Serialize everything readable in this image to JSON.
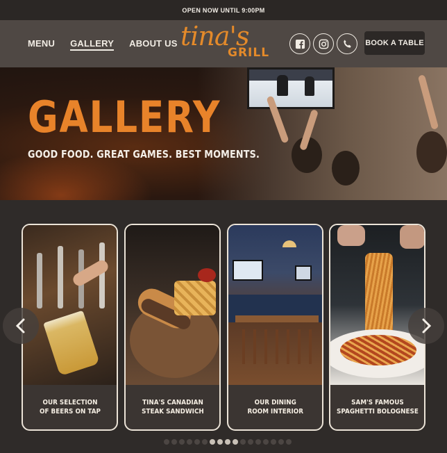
{
  "topbar": {
    "text": "OPEN NOW UNTIL 9:00PM"
  },
  "nav": {
    "links": [
      {
        "label": "MENU",
        "active": false
      },
      {
        "label": "GALLERY",
        "active": true
      },
      {
        "label": "ABOUT US",
        "active": false
      }
    ],
    "logo": {
      "script": "tina's",
      "wordmark": "GRILL"
    },
    "social": [
      "facebook-icon",
      "instagram-icon",
      "phone-icon"
    ],
    "book_label": "BOOK A TABLE"
  },
  "hero": {
    "title": "GALLERY",
    "subtitle": "GOOD FOOD. GREAT GAMES. BEST MOMENTS."
  },
  "gallery": {
    "cards": [
      {
        "caption": "OUR SELECTION\nOF BEERS ON TAP",
        "image": "beer-tap-photo"
      },
      {
        "caption": "TINA'S CANADIAN\nSTEAK SANDWICH",
        "image": "steak-sandwich-photo"
      },
      {
        "caption": "OUR DINING\nROOM INTERIOR",
        "image": "dining-room-photo"
      },
      {
        "caption": "SAM'S FAMOUS\nSPAGHETTI BOLOGNESE",
        "image": "spaghetti-photo"
      }
    ],
    "prev_icon": "chevron-left-icon",
    "next_icon": "chevron-right-icon",
    "dots_total": 17,
    "dots_active": [
      6,
      7,
      8,
      9
    ]
  },
  "colors": {
    "accent": "#e8832a",
    "nav_bg": "#4f4844",
    "page_bg": "#2f2b29"
  }
}
